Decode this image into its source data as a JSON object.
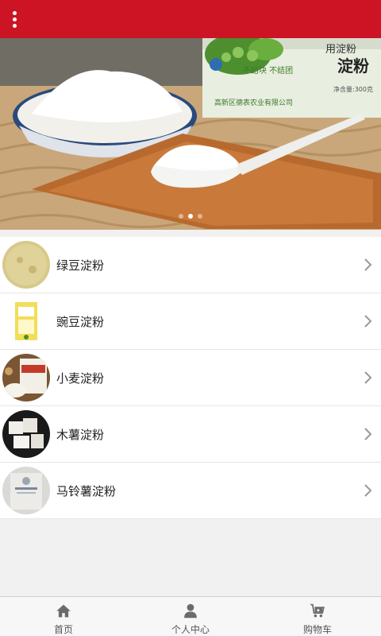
{
  "header": {
    "menu_icon": "more-vertical-icon",
    "color": "#cc1425"
  },
  "banner": {
    "package_text_1": "用淀粉",
    "package_text_2": "淀粉",
    "package_text_3": "不结块 不结团",
    "package_text_4": "净含量:300克",
    "package_text_5": "高新区德表农业有限公司",
    "slides_total": 3,
    "active_slide": 2
  },
  "products": [
    {
      "label": "绿豆淀粉",
      "thumb": "green-bean-starch"
    },
    {
      "label": "豌豆淀粉",
      "thumb": "pea-starch"
    },
    {
      "label": "小麦淀粉",
      "thumb": "wheat-starch"
    },
    {
      "label": "木薯淀粉",
      "thumb": "tapioca-starch"
    },
    {
      "label": "马铃薯淀粉",
      "thumb": "potato-starch"
    }
  ],
  "tabbar": [
    {
      "label": "首页",
      "icon": "home-icon"
    },
    {
      "label": "个人中心",
      "icon": "user-icon"
    },
    {
      "label": "购物车",
      "icon": "cart-icon"
    }
  ]
}
